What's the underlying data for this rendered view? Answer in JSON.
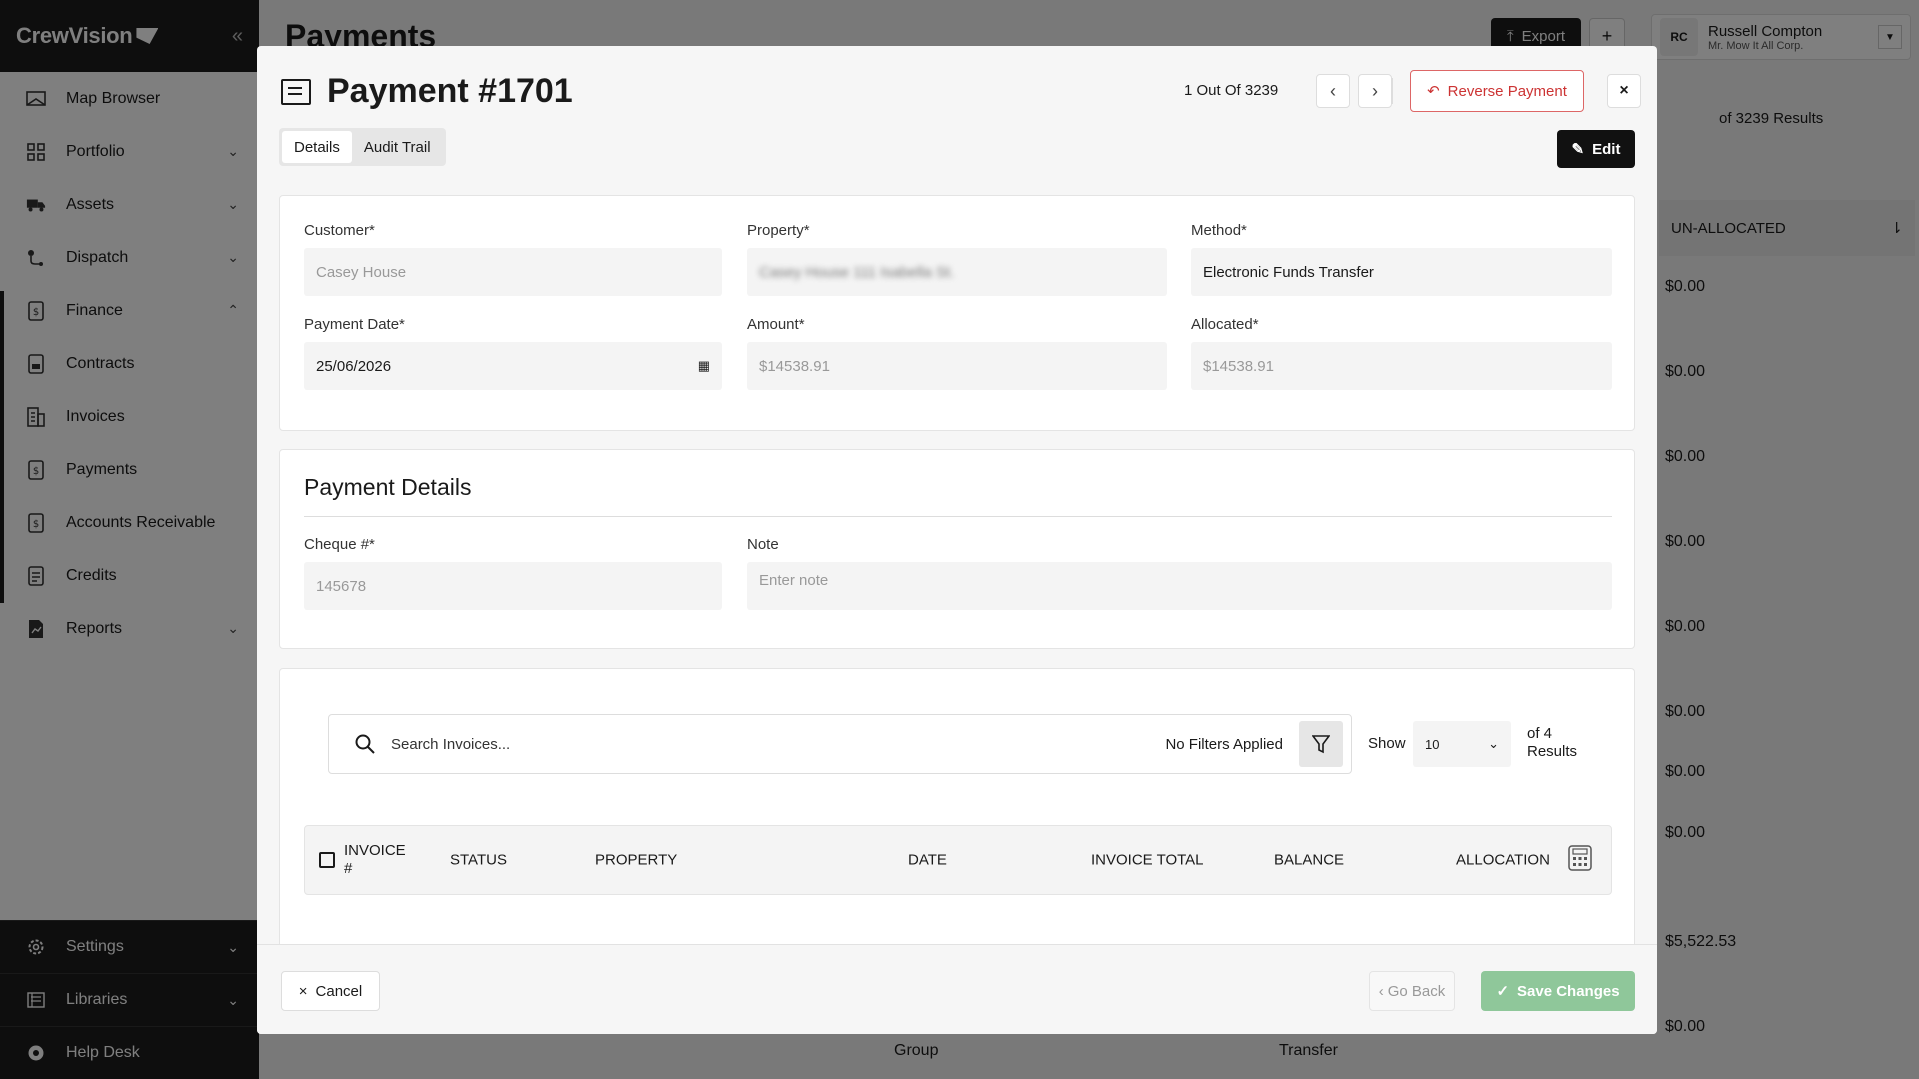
{
  "app": {
    "brand": "CrewVision"
  },
  "sidebar": {
    "items": [
      {
        "label": "Map Browser",
        "icon": "map-icon"
      },
      {
        "label": "Portfolio",
        "icon": "grid-icon"
      },
      {
        "label": "Assets",
        "icon": "truck-icon"
      },
      {
        "label": "Dispatch",
        "icon": "route-icon"
      },
      {
        "label": "Finance",
        "icon": "dollar-doc-icon"
      },
      {
        "label": "Contracts",
        "icon": "contract-icon"
      },
      {
        "label": "Invoices",
        "icon": "invoice-icon"
      },
      {
        "label": "Payments",
        "icon": "payment-icon"
      },
      {
        "label": "Accounts Receivable",
        "icon": "receivable-icon"
      },
      {
        "label": "Credits",
        "icon": "credit-icon"
      },
      {
        "label": "Reports",
        "icon": "report-icon"
      }
    ],
    "bottom": [
      {
        "label": "Settings"
      },
      {
        "label": "Libraries"
      },
      {
        "label": "Help Desk"
      }
    ]
  },
  "background": {
    "page_title": "Payments",
    "export_label": "Export",
    "add_label": "+",
    "user_initials": "RC",
    "user_name": "Russell Compton",
    "user_company": "Mr. Mow It All Corp.",
    "results_text": "of 3239 Results",
    "column": "UN-ALLOCATED",
    "values": [
      "$0.00",
      "$0.00",
      "$0.00",
      "$0.00",
      "$0.00",
      "$0.00",
      "$0.00",
      "$0.00",
      "$5,522.53",
      "$0.00"
    ],
    "row_fragments": [
      "Group",
      "Transfer"
    ]
  },
  "modal": {
    "title": "Payment #1701",
    "pager_text": "1 Out Of 3239",
    "reverse_label": "Reverse Payment",
    "close_label": "×",
    "tabs": [
      "Details",
      "Audit Trail"
    ],
    "edit_label": "Edit",
    "fields": {
      "customer_label": "Customer*",
      "customer_value": "Casey House",
      "property_label": "Property*",
      "property_value": "Casey House 111 Isabella St.",
      "method_label": "Method*",
      "method_value": "Electronic Funds Transfer",
      "date_label": "Payment Date*",
      "date_value": "25/06/2026",
      "amount_label": "Amount*",
      "amount_value": "$14538.91",
      "allocated_label": "Allocated*",
      "allocated_value": "$14538.91"
    },
    "payment_details": {
      "title": "Payment Details",
      "cheque_label": "Cheque #*",
      "cheque_value": "145678",
      "note_label": "Note",
      "note_placeholder": "Enter note"
    },
    "invoices": {
      "search_placeholder": "Search Invoices...",
      "filters_text": "No Filters Applied",
      "show_label": "Show",
      "show_value": "10",
      "of_results": "of 4",
      "results_word": "Results",
      "columns": [
        "INVOICE #",
        "STATUS",
        "PROPERTY",
        "DATE",
        "INVOICE TOTAL",
        "BALANCE",
        "ALLOCATION"
      ]
    },
    "footer": {
      "cancel_label": "Cancel",
      "go_back_label": "Go Back",
      "save_label": "Save Changes"
    }
  }
}
